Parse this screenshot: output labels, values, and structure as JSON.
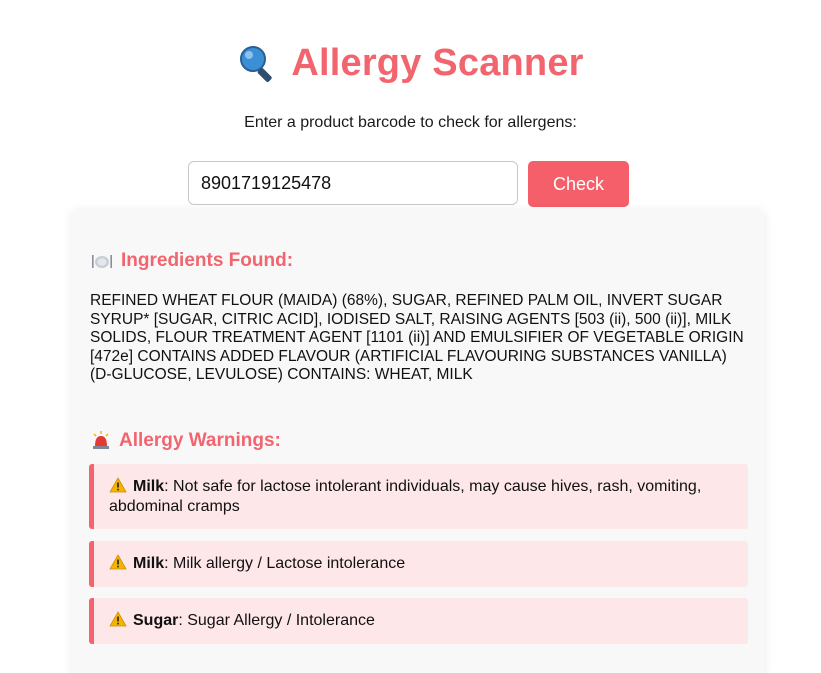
{
  "header": {
    "title": "Allergy Scanner",
    "title_icon": "magnifying-glass-icon",
    "subtitle": "Enter a product barcode to check for allergens:"
  },
  "search": {
    "barcode_value": "8901719125478",
    "check_label": "Check"
  },
  "results": {
    "ingredients_heading": "Ingredients Found:",
    "ingredients_icon": "plate-cutlery-icon",
    "ingredients_text": "REFINED WHEAT FLOUR (MAIDA) (68%), SUGAR, REFINED PALM OIL, INVERT SUGAR SYRUP* [SUGAR, CITRIC ACID], IODISED SALT, RAISING AGENTS [503 (ii), 500 (ii)], MILK SOLIDS, FLOUR TREATMENT AGENT [1101 (ii)] AND EMULSIFIER OF VEGETABLE ORIGIN [472e] CONTAINS ADDED FLAVOUR (ARTIFICIAL FLAVOURING SUBSTANCES VANILLA) (D-GLUCOSE, LEVULOSE) CONTAINS: WHEAT, MILK",
    "warnings_heading": "Allergy Warnings:",
    "warnings_icon": "siren-light-icon",
    "warnings": [
      {
        "allergen": "Milk",
        "description": ": Not safe for lactose intolerant individuals, may cause hives, rash, vomiting, abdominal cramps"
      },
      {
        "allergen": "Milk",
        "description": ": Milk allergy / Lactose intolerance"
      },
      {
        "allergen": "Sugar",
        "description": ": Sugar Allergy / Intolerance"
      }
    ]
  },
  "colors": {
    "accent": "#f2656e",
    "button": "#f55f69",
    "warning_bg": "#fde7e8",
    "card_bg": "#f8f8f8"
  }
}
